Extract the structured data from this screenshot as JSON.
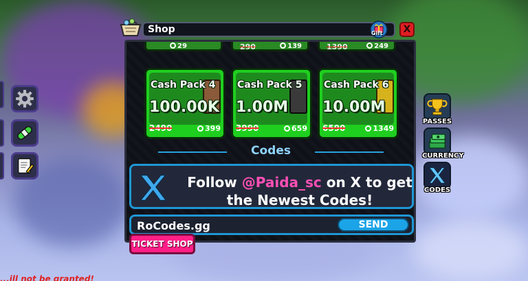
{
  "shop": {
    "title": "Shop",
    "gift_label": "Gift",
    "close_label": "X"
  },
  "top_row": [
    {
      "old_price": "",
      "price": "29"
    },
    {
      "old_price": "290",
      "price": "139"
    },
    {
      "old_price": "1390",
      "price": "249"
    }
  ],
  "packs": [
    {
      "name": "Cash Pack 4",
      "amount": "100.00K",
      "old_price": "2490",
      "price": "399",
      "box_color": "#8a5a3a"
    },
    {
      "name": "Cash Pack 5",
      "amount": "1.00M",
      "old_price": "3990",
      "price": "659",
      "box_color": "#3a3a3a"
    },
    {
      "name": "Cash Pack 6",
      "amount": "10.00M",
      "old_price": "6590",
      "price": "1349",
      "box_color": "#d6b21c"
    }
  ],
  "codes": {
    "header": "Codes",
    "follow_prefix": "Follow ",
    "handle": "@Paida_sc",
    "follow_suffix": " on X to get",
    "line2": "the Newest Codes!",
    "input_value": "RoCodes.gg",
    "send_label": "SEND"
  },
  "ticket_shop_label": "TICKET SHOP",
  "right_menu": [
    {
      "label": "PASSES",
      "icon": "trophy-icon"
    },
    {
      "label": "CURRENCY",
      "icon": "money-stack-icon"
    },
    {
      "label": "CODES",
      "icon": "x-logo-icon"
    }
  ],
  "bottom_notice": "...ill not be granted!",
  "colors": {
    "accent_blue": "#1f96d4",
    "pack_green": "#1fcf1f",
    "ticket_pink": "#ff1f87",
    "handle_pink": "#ff4fb4",
    "close_red": "#e01e22"
  }
}
